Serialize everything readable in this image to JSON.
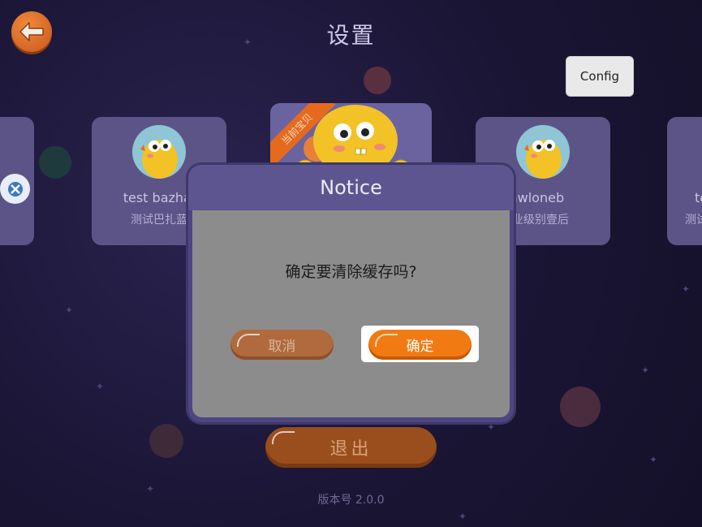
{
  "header": {
    "title": "设置",
    "back_icon": "arrow-left-icon",
    "config_label": "Config"
  },
  "profiles": [
    {
      "name": "",
      "subtitle": ""
    },
    {
      "name": "test bazhal",
      "subtitle": "测试巴扎蓝"
    },
    {
      "name": "",
      "subtitle": "",
      "badge": "当前宝贝"
    },
    {
      "name": "sthwloneb",
      "subtitle": "C作业级别壹后"
    },
    {
      "name": "te",
      "subtitle": "测试"
    }
  ],
  "dialog": {
    "title": "Notice",
    "message": "确定要清除缓存吗?",
    "cancel_label": "取消",
    "confirm_label": "确定"
  },
  "footer": {
    "logout_label": "退出",
    "version": "版本号 2.0.0"
  },
  "colors": {
    "background": "#1c1736",
    "accent_orange": "#f27a12",
    "card": "#5c5487",
    "dialog_header": "#5d5590",
    "dialog_body": "#8c8c8c"
  }
}
